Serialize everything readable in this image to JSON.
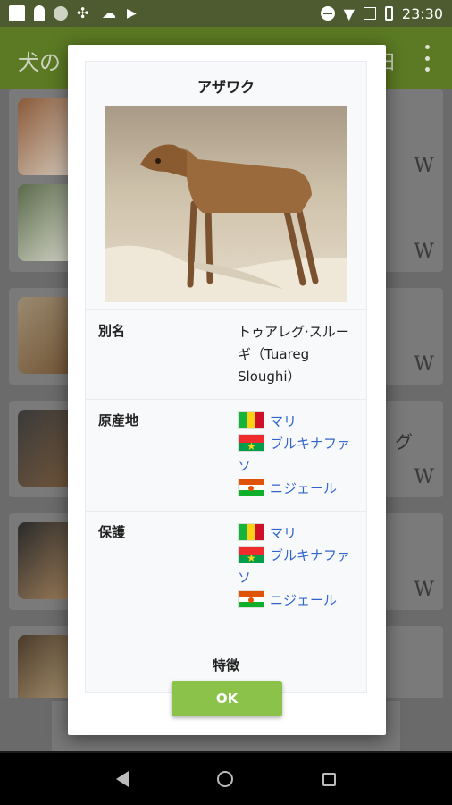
{
  "status_bar": {
    "time": "23:30"
  },
  "app_bar": {
    "title": "犬の",
    "title_right": "田"
  },
  "background_list": {
    "cards": [
      {
        "text": "",
        "mark": "W"
      },
      {
        "text": "",
        "mark": "W"
      },
      {
        "text": "",
        "mark": "W"
      },
      {
        "text": "グ",
        "mark": "W"
      },
      {
        "text": "",
        "mark": "W"
      }
    ]
  },
  "dialog": {
    "title": "アザワク",
    "rows": [
      {
        "label": "別名",
        "value": "トゥアレグ·スルーギ（Tuareg Sloughi）"
      },
      {
        "label": "原産地",
        "links": [
          "マリ",
          "ブルキナファソ",
          "ニジェール"
        ]
      },
      {
        "label": "保護",
        "links": [
          "マリ",
          "ブルキナファソ",
          "ニジェール"
        ]
      }
    ],
    "section_heading": "特徴",
    "ok_label": "OK"
  }
}
